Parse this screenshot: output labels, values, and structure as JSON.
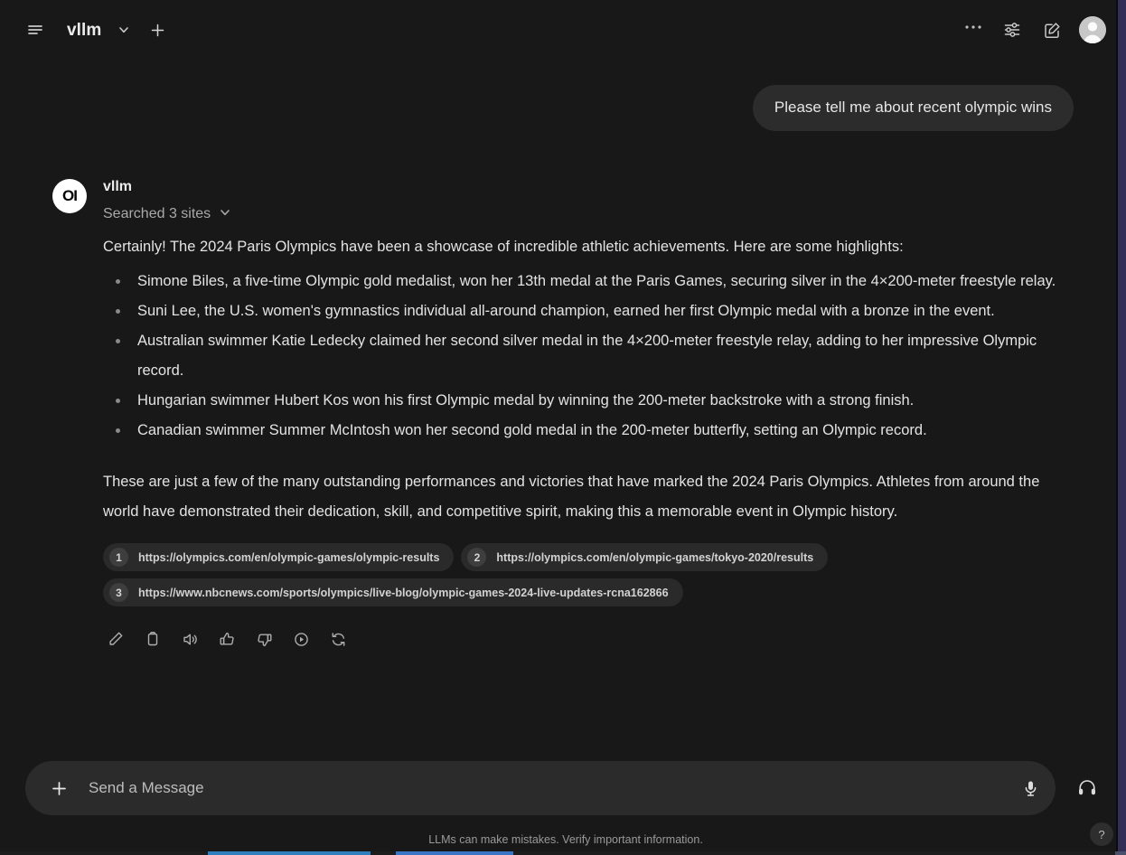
{
  "app": {
    "background": "#181818",
    "accent_edge": "#322e55"
  },
  "header": {
    "menu_icon": "hamburger-menu-icon",
    "title": "vllm",
    "chevron_icon": "chevron-down-icon",
    "new_chat_icon": "plus-icon",
    "more_icon": "ellipsis-icon",
    "settings_icon": "sliders-icon",
    "compose_icon": "compose-icon",
    "avatar_icon": "user-avatar"
  },
  "conversation": {
    "user_message": "Please tell me about recent olympic wins",
    "assistant": {
      "logo_text": "OI",
      "name": "vllm",
      "search_status": "Searched 3 sites",
      "search_chevron": "chevron-down-icon",
      "intro": "Certainly! The 2024 Paris Olympics have been a showcase of incredible athletic achievements. Here are some highlights:",
      "bullets": [
        "Simone Biles, a five-time Olympic gold medalist, won her 13th medal at the Paris Games, securing silver in the 4×200-meter freestyle relay.",
        "Suni Lee, the U.S. women's gymnastics individual all-around champion, earned her first Olympic medal with a bronze in the event.",
        "Australian swimmer Katie Ledecky claimed her second silver medal in the 4×200-meter freestyle relay, adding to her impressive Olympic record.",
        "Hungarian swimmer Hubert Kos won his first Olympic medal by winning the 200-meter backstroke with a strong finish.",
        "Canadian swimmer Summer McIntosh won her second gold medal in the 200-meter butterfly, setting an Olympic record."
      ],
      "closing": "These are just a few of the many outstanding performances and victories that have marked the 2024 Paris Olympics. Athletes from around the world have demonstrated their dedication, skill, and competitive spirit, making this a memorable event in Olympic history.",
      "citations": [
        {
          "num": "1",
          "url": "https://olympics.com/en/olympic-games/olympic-results"
        },
        {
          "num": "2",
          "url": "https://olympics.com/en/olympic-games/tokyo-2020/results"
        },
        {
          "num": "3",
          "url": "https://www.nbcnews.com/sports/olympics/live-blog/olympic-games-2024-live-updates-rcna162866"
        }
      ],
      "actions": [
        "edit-icon",
        "copy-icon",
        "read-aloud-icon",
        "thumbs-up-icon",
        "thumbs-down-icon",
        "play-circle-icon",
        "regenerate-icon"
      ]
    }
  },
  "composer": {
    "attach_icon": "plus-icon",
    "placeholder": "Send a Message",
    "value": "",
    "mic_icon": "microphone-icon",
    "headset_icon": "headphones-icon"
  },
  "footer": {
    "disclaimer": "LLMs can make mistakes. Verify important information.",
    "help_label": "?"
  },
  "taskbar": {
    "segments": [
      "#1c1c1c",
      "#2f7fbf",
      "#1c1c1c",
      "#3a74c4",
      "#1c1c1c",
      "#4a4f6a",
      "#1c1c1c"
    ]
  }
}
